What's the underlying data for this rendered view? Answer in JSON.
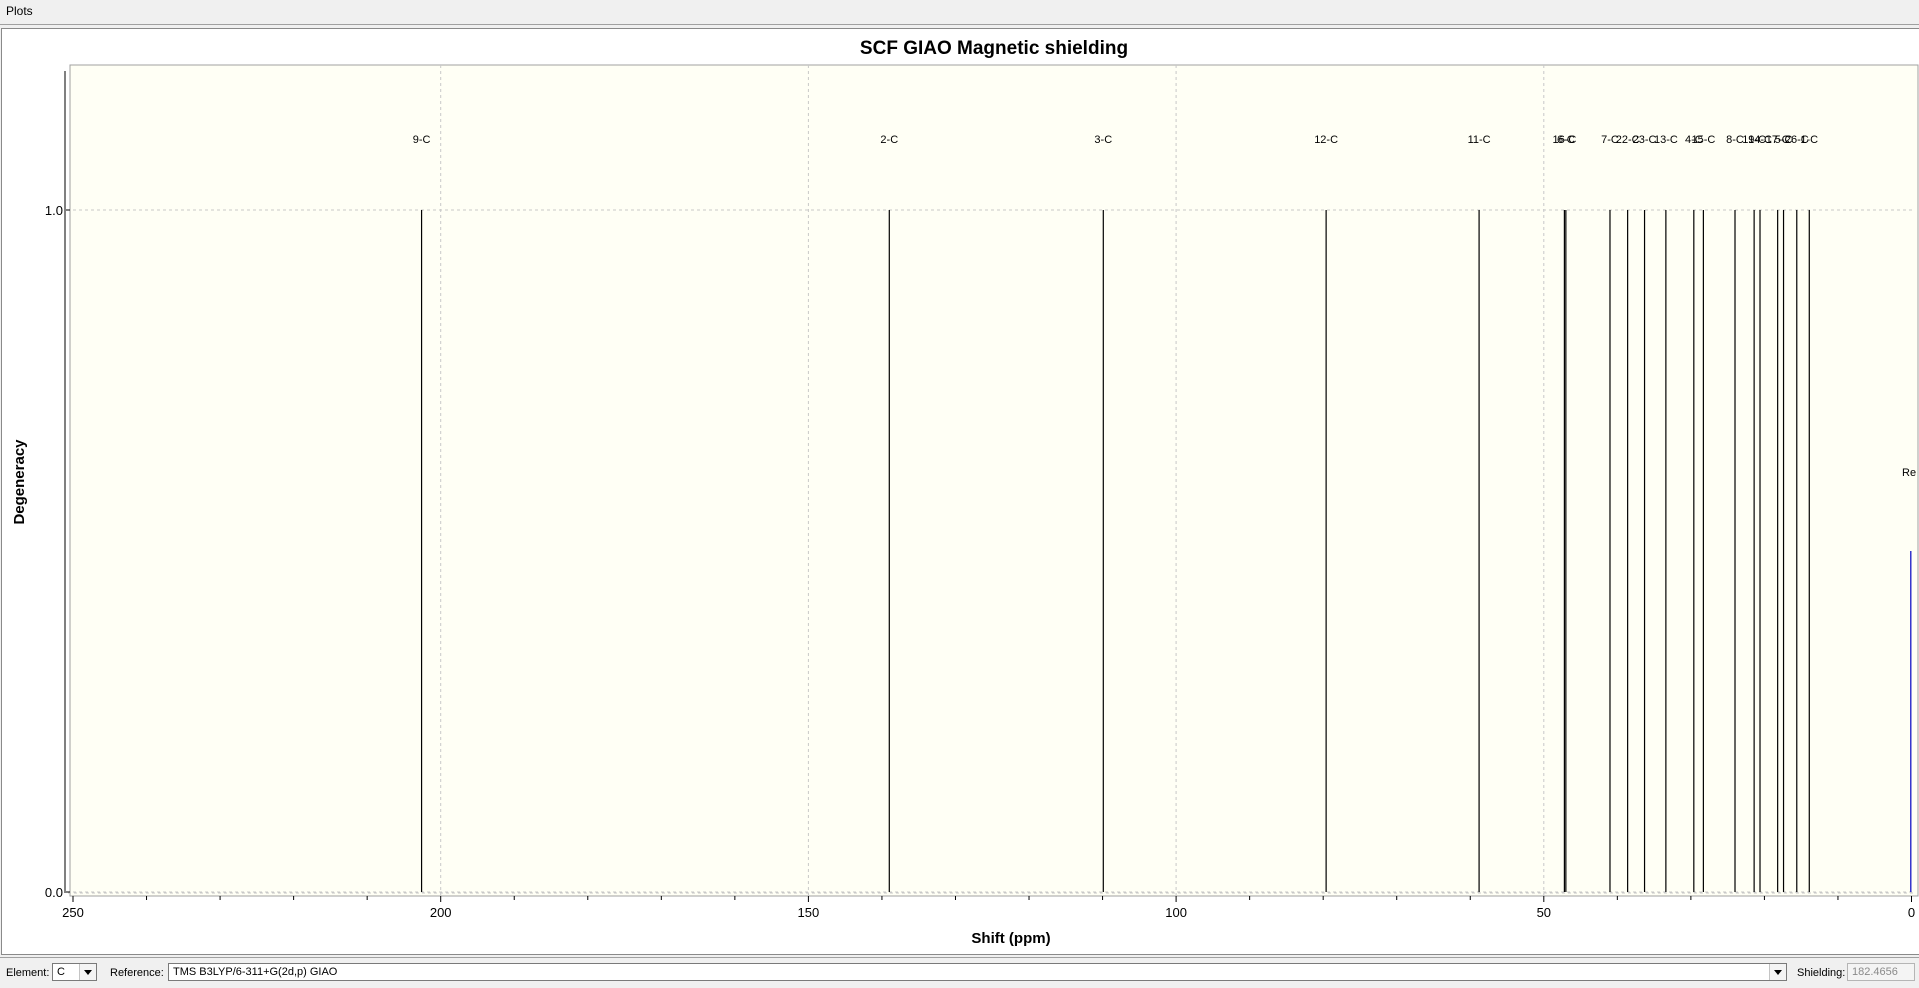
{
  "window": {
    "title": "Plots"
  },
  "chart_data": {
    "type": "bar",
    "title": "SCF GIAO Magnetic shielding",
    "xlabel": "Shift (ppm)",
    "ylabel": "Degeneracy",
    "xlim": [
      250,
      0
    ],
    "ylim": [
      0,
      1.2
    ],
    "x_reversed": true,
    "grid": true,
    "x_ticks": [
      {
        "value": 250,
        "label": "250"
      },
      {
        "value": 200,
        "label": "200"
      },
      {
        "value": 150,
        "label": "150"
      },
      {
        "value": 100,
        "label": "100"
      },
      {
        "value": 50,
        "label": "50"
      },
      {
        "value": 0,
        "label": "0"
      }
    ],
    "y_ticks": [
      {
        "value": 0,
        "label": "0.0"
      },
      {
        "value": 1,
        "label": "1.0"
      }
    ],
    "peaks": [
      {
        "label": "9-C",
        "x": 202.6,
        "y": 1
      },
      {
        "label": "2-C",
        "x": 139.0,
        "y": 1
      },
      {
        "label": "3-C",
        "x": 109.9,
        "y": 1
      },
      {
        "label": "12-C",
        "x": 79.6,
        "y": 1
      },
      {
        "label": "11-C",
        "x": 58.8,
        "y": 1
      },
      {
        "label": "16-C",
        "x": 47.2,
        "y": 1
      },
      {
        "label": "6-C",
        "x": 47.0,
        "y": 1
      },
      {
        "label": "7-C",
        "x": 41.0,
        "y": 1
      },
      {
        "label": "22-C",
        "x": 38.6,
        "y": 1
      },
      {
        "label": "23-C",
        "x": 36.3,
        "y": 1
      },
      {
        "label": "13-C",
        "x": 33.4,
        "y": 1
      },
      {
        "label": "4-C",
        "x": 29.6,
        "y": 1
      },
      {
        "label": "15-C",
        "x": 28.3,
        "y": 1
      },
      {
        "label": "8-C",
        "x": 24.0,
        "y": 1
      },
      {
        "label": "19-C",
        "x": 21.4,
        "y": 1
      },
      {
        "label": "14-C",
        "x": 20.6,
        "y": 1
      },
      {
        "label": "17-C",
        "x": 18.2,
        "y": 1
      },
      {
        "label": "5-C",
        "x": 17.4,
        "y": 1
      },
      {
        "label": "26-C",
        "x": 15.6,
        "y": 1
      },
      {
        "label": "1-C",
        "x": 13.9,
        "y": 1
      }
    ],
    "reference_line": {
      "label": "Re",
      "x": 0.1,
      "y": 0.5,
      "color": "#3333cc"
    },
    "colors": {
      "peak": "#000000",
      "grid": "#c8c8c8",
      "plot_bg": "#fffff5",
      "axis_text": "#000000"
    }
  },
  "controls": {
    "element_label": "Element:",
    "element_value": "C",
    "reference_label": "Reference:",
    "reference_value": "TMS B3LYP/6-311+G(2d,p) GIAO",
    "shielding_label": "Shielding:",
    "shielding_value": "182.4656"
  }
}
